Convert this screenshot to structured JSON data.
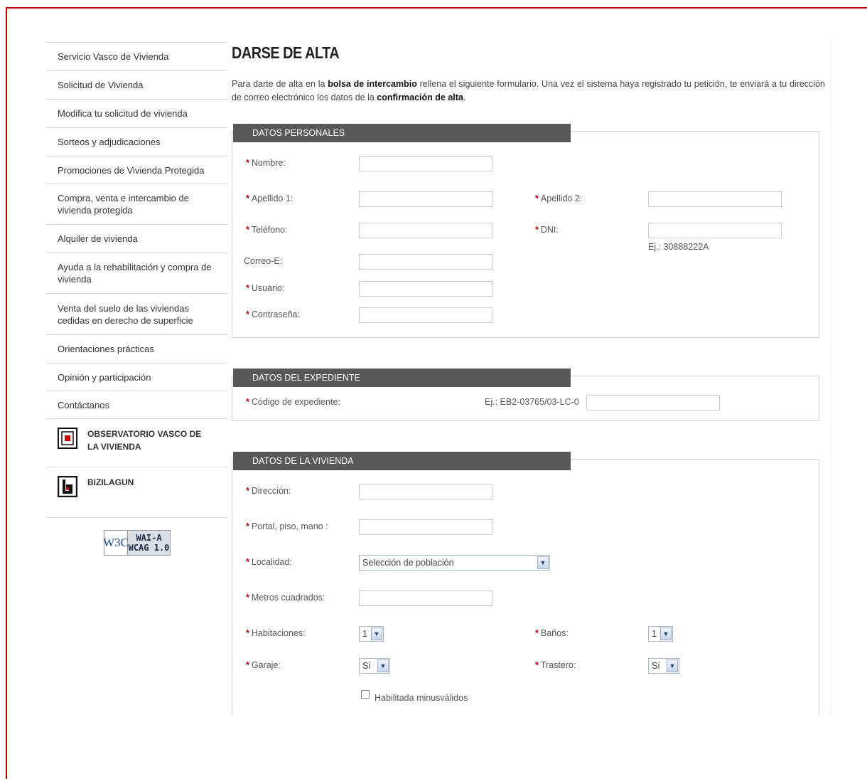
{
  "sidebar": {
    "items": [
      {
        "label": "Servicio Vasco de Vivienda"
      },
      {
        "label": "Solicitud de Vivienda"
      },
      {
        "label": "Modifica tu solicitud de vivienda"
      },
      {
        "label": "Sorteos y adjudicaciones"
      },
      {
        "label": "Promociones de Vivienda Protegida"
      },
      {
        "label": "Compra, venta e intercambio de vivienda protegida"
      },
      {
        "label": "Alquiler de vivienda"
      },
      {
        "label": "Ayuda a la rehabilitación y compra de vivienda"
      },
      {
        "label": "Venta del suelo de las viviendas cedidas en derecho de superficie"
      },
      {
        "label": "Orientaciones prácticas"
      },
      {
        "label": "Opinión y participación"
      },
      {
        "label": "Contáctanos"
      }
    ],
    "observatorio": "OBSERVATORIO VASCO DE LA VIVIENDA",
    "bizilagun": "BIZILAGUN",
    "badge": {
      "w3c": "W3C",
      "wai": "WAI-A",
      "wcag": "WCAG 1.0"
    }
  },
  "main": {
    "title": "DARSE DE ALTA",
    "intro": {
      "p1": "Para darte de alta en la ",
      "b1": "bolsa de intercambio",
      "p2": " rellena el siguiente formulario. Una vez el sistema haya registrado tu petición, te enviará a tu dirección de correo electrónico los datos de la ",
      "b2": "confirmación de alta",
      "p3": "."
    },
    "required_mark": "*",
    "datos_personales": {
      "title": "DATOS PERSONALES",
      "nombre": "Nombre:",
      "apellido1": "Apellido 1:",
      "apellido2": "Apellido 2:",
      "telefono": "Teléfono:",
      "dni": "DNI:",
      "dni_hint": "Ej.: 30888222A",
      "correo": "Correo-E:",
      "usuario": "Usuario:",
      "contrasena": "Contraseña:"
    },
    "datos_expediente": {
      "title": "DATOS DEL EXPEDIENTE",
      "codigo": "Código de expediente:",
      "codigo_hint": "Ej.: EB2-03765/03-LC-0"
    },
    "datos_vivienda": {
      "title": "DATOS DE LA VIVIENDA",
      "direccion": "Dirección:",
      "portal": "Portal, piso, mano :",
      "localidad": "Localidad:",
      "localidad_value": "Selección de población",
      "metros": "Metros cuadrados:",
      "habitaciones": "Habitaciones:",
      "habitaciones_value": "1",
      "banos": "Baños:",
      "banos_value": "1",
      "garaje": "Garaje:",
      "garaje_value": "Sí",
      "trastero": "Trastero:",
      "trastero_value": "Sí",
      "minusvalidos": "Habilitada minusválidos",
      "minusvalidos_checked": false
    }
  }
}
